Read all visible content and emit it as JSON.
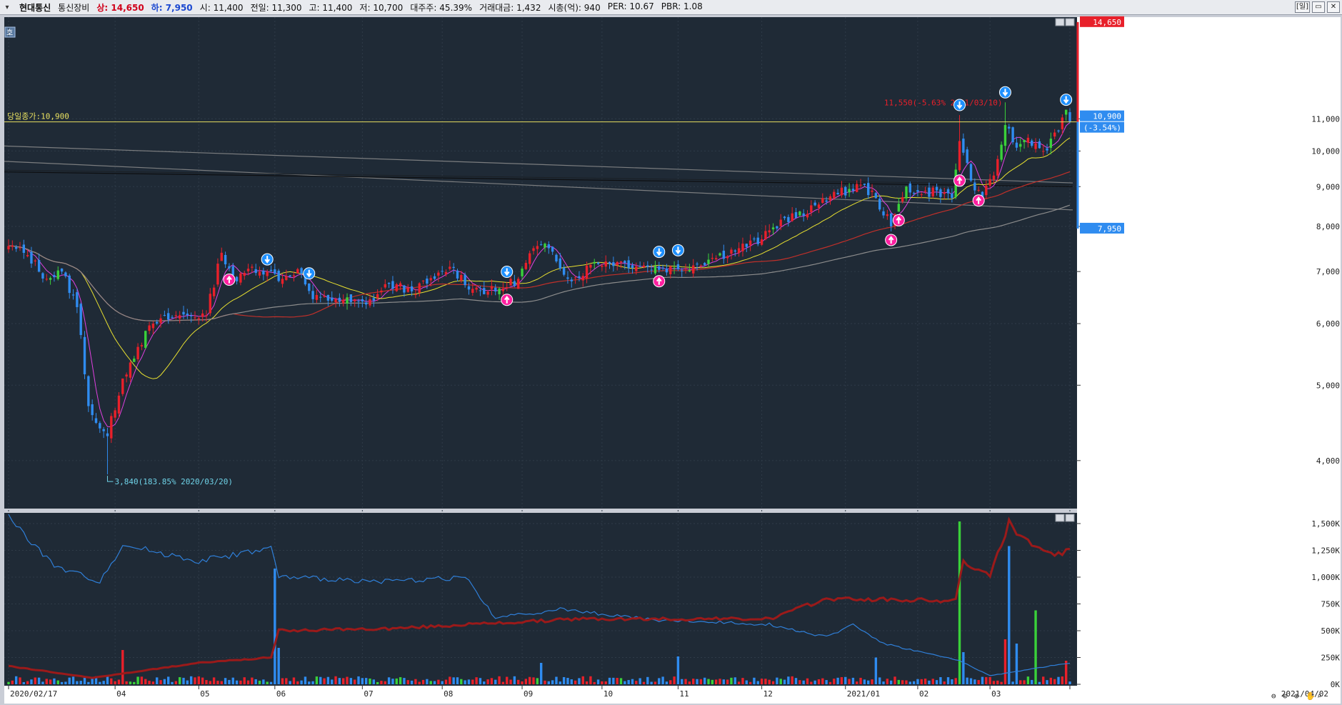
{
  "header": {
    "menu_icon": "chevron-down-icon",
    "stock_name": "현대통신",
    "sector": "통신장비",
    "items": [
      {
        "label": "상:",
        "value": "14,650",
        "color": "up"
      },
      {
        "label": "하:",
        "value": "7,950",
        "color": "dn"
      },
      {
        "label": "시:",
        "value": "11,400",
        "color": "plain"
      },
      {
        "label": "전일:",
        "value": "11,300",
        "color": "plain"
      },
      {
        "label": "고:",
        "value": "11,400",
        "color": "plain"
      },
      {
        "label": "저:",
        "value": "10,700",
        "color": "plain"
      },
      {
        "label": "대주주:",
        "value": "45.39%",
        "color": "plain"
      },
      {
        "label": "거래대금:",
        "value": "1,432",
        "color": "plain"
      },
      {
        "label": "시총(억):",
        "value": "940",
        "color": "plain"
      },
      {
        "label": "PER:",
        "value": "10.67",
        "color": "plain"
      },
      {
        "label": "PBR:",
        "value": "1.08",
        "color": "plain"
      }
    ],
    "period_button": "[일]",
    "window_buttons": [
      "▭",
      "✕"
    ]
  },
  "colors": {
    "background": "#1f2a36",
    "grid": "#2f3b48",
    "up": "#e8202a",
    "down": "#2f8cf0",
    "up_alt": "#3ad13a",
    "ma5": "#e040e0",
    "ma20": "#e8e030",
    "ma60": "#c0302a",
    "ma120": "#8c8c8c",
    "ref_line": "#e8e060",
    "hline": "#0a0a0a",
    "sell_signal": "#1e90ff",
    "buy_signal": "#ff1fa0",
    "vol_line_red": "#9b1a1a",
    "vol_line_blue": "#2f7fd8"
  },
  "panel_label": "호",
  "chart_data": {
    "type": "candlestick",
    "x_start": "2020/02/17",
    "x_end": "2021/04/02",
    "month_ticks": [
      "2020/02/17",
      "04",
      "05",
      "06",
      "07",
      "08",
      "09",
      "10",
      "11",
      "12",
      "2021/01",
      "02",
      "03",
      "2021/04/02"
    ],
    "price_axis": {
      "ticks": [
        4000,
        5000,
        6000,
        7000,
        8000,
        9000,
        10000,
        11000
      ],
      "labels": [
        "4,000",
        "5,000",
        "6,000",
        "7,000",
        "8,000",
        "9,000",
        "10,000",
        "11,000"
      ],
      "ylim": [
        3500,
        14800
      ]
    },
    "volume_axis": {
      "ticks": [
        0,
        250,
        500,
        750,
        1000,
        1250,
        1500
      ],
      "labels": [
        "0K",
        "250K",
        "500K",
        "750K",
        "1,000K",
        "1,250K",
        "1,500K"
      ],
      "ylim": [
        0,
        1560
      ]
    },
    "ref_line": {
      "label": "당일종가:10,900",
      "value": 10900
    },
    "annotations": [
      {
        "text": "3,840(183.85% 2020/03/20)",
        "date_index": 26,
        "value": 3840
      },
      {
        "text": "11,550(-5.63% 2021/03/10)",
        "date_index": 262,
        "value": 11550
      }
    ],
    "price_tags": [
      {
        "text": "14,650",
        "kind": "upper",
        "value": 14650
      },
      {
        "text": "10,900",
        "kind": "current",
        "value": 10900
      },
      {
        "text": "(-3.54%)",
        "kind": "current_pct",
        "value": 10900
      },
      {
        "text": "7,950",
        "kind": "lower",
        "value": 7950
      }
    ],
    "key_points": [
      {
        "i": 0,
        "c": 7550
      },
      {
        "i": 5,
        "c": 7350
      },
      {
        "i": 10,
        "c": 6850
      },
      {
        "i": 14,
        "c": 7000
      },
      {
        "i": 18,
        "c": 6300
      },
      {
        "i": 21,
        "c": 4700
      },
      {
        "i": 24,
        "c": 4400
      },
      {
        "i": 26,
        "c": 4300
      },
      {
        "i": 30,
        "c": 5100
      },
      {
        "i": 34,
        "c": 5600
      },
      {
        "i": 38,
        "c": 6000
      },
      {
        "i": 45,
        "c": 6150
      },
      {
        "i": 52,
        "c": 6150
      },
      {
        "i": 56,
        "c": 7400
      },
      {
        "i": 60,
        "c": 6800
      },
      {
        "i": 64,
        "c": 7100
      },
      {
        "i": 68,
        "c": 7000
      },
      {
        "i": 72,
        "c": 6850
      },
      {
        "i": 76,
        "c": 7050
      },
      {
        "i": 80,
        "c": 6450
      },
      {
        "i": 86,
        "c": 6450
      },
      {
        "i": 94,
        "c": 6350
      },
      {
        "i": 100,
        "c": 6750
      },
      {
        "i": 106,
        "c": 6600
      },
      {
        "i": 112,
        "c": 6850
      },
      {
        "i": 116,
        "c": 7100
      },
      {
        "i": 122,
        "c": 6650
      },
      {
        "i": 128,
        "c": 6600
      },
      {
        "i": 134,
        "c": 6850
      },
      {
        "i": 138,
        "c": 7500
      },
      {
        "i": 142,
        "c": 7500
      },
      {
        "i": 148,
        "c": 6800
      },
      {
        "i": 154,
        "c": 7200
      },
      {
        "i": 160,
        "c": 7200
      },
      {
        "i": 168,
        "c": 7100
      },
      {
        "i": 176,
        "c": 7050
      },
      {
        "i": 184,
        "c": 7250
      },
      {
        "i": 192,
        "c": 7500
      },
      {
        "i": 198,
        "c": 7700
      },
      {
        "i": 204,
        "c": 8200
      },
      {
        "i": 210,
        "c": 8300
      },
      {
        "i": 214,
        "c": 8700
      },
      {
        "i": 218,
        "c": 8800
      },
      {
        "i": 224,
        "c": 9050
      },
      {
        "i": 228,
        "c": 8700
      },
      {
        "i": 232,
        "c": 8000
      },
      {
        "i": 236,
        "c": 9000
      },
      {
        "i": 240,
        "c": 8800
      },
      {
        "i": 244,
        "c": 8900
      },
      {
        "i": 248,
        "c": 8700
      },
      {
        "i": 250,
        "c": 10300
      },
      {
        "i": 254,
        "c": 8900
      },
      {
        "i": 256,
        "c": 8700
      },
      {
        "i": 259,
        "c": 9300
      },
      {
        "i": 262,
        "c": 10800
      },
      {
        "i": 265,
        "c": 10100
      },
      {
        "i": 268,
        "c": 10400
      },
      {
        "i": 272,
        "c": 10000
      },
      {
        "i": 276,
        "c": 10600
      },
      {
        "i": 278,
        "c": 11300
      },
      {
        "i": 279,
        "c": 10900
      }
    ],
    "n_days": 280,
    "moving_averages": [
      {
        "period": 5,
        "color_key": "ma5"
      },
      {
        "period": 20,
        "color_key": "ma20"
      },
      {
        "period": 60,
        "color_key": "ma60"
      },
      {
        "period": 120,
        "color_key": "ma120"
      }
    ],
    "long_lines": [
      {
        "start": 10150,
        "end": 9100,
        "color_key": "ma120"
      },
      {
        "start": 9700,
        "end": 8400,
        "color_key": "ma120"
      },
      {
        "start": 9400,
        "end": 9000,
        "color_key": "hline"
      }
    ],
    "sell_signals": [
      68,
      79,
      131,
      171,
      176,
      250,
      262,
      278
    ],
    "buy_signals": [
      58,
      131,
      171,
      232,
      234,
      250,
      255
    ],
    "volume_spikes": [
      {
        "i": 30,
        "v": 320
      },
      {
        "i": 70,
        "v": 1080
      },
      {
        "i": 71,
        "v": 340
      },
      {
        "i": 140,
        "v": 200
      },
      {
        "i": 176,
        "v": 260
      },
      {
        "i": 228,
        "v": 250
      },
      {
        "i": 250,
        "v": 1520
      },
      {
        "i": 251,
        "v": 300
      },
      {
        "i": 262,
        "v": 420
      },
      {
        "i": 263,
        "v": 1290
      },
      {
        "i": 265,
        "v": 380
      },
      {
        "i": 270,
        "v": 690
      },
      {
        "i": 278,
        "v": 220
      }
    ],
    "volume_line_red_points": [
      {
        "i": 0,
        "v": 170
      },
      {
        "i": 22,
        "v": 60
      },
      {
        "i": 50,
        "v": 200
      },
      {
        "i": 69,
        "v": 250
      },
      {
        "i": 71,
        "v": 500
      },
      {
        "i": 100,
        "v": 520
      },
      {
        "i": 150,
        "v": 610
      },
      {
        "i": 200,
        "v": 610
      },
      {
        "i": 215,
        "v": 800
      },
      {
        "i": 249,
        "v": 780
      },
      {
        "i": 251,
        "v": 1150
      },
      {
        "i": 258,
        "v": 1010
      },
      {
        "i": 263,
        "v": 1500
      },
      {
        "i": 270,
        "v": 1260
      },
      {
        "i": 275,
        "v": 1190
      },
      {
        "i": 279,
        "v": 1280
      }
    ],
    "volume_line_blue_points": [
      {
        "i": 0,
        "v": 1560
      },
      {
        "i": 12,
        "v": 1100
      },
      {
        "i": 24,
        "v": 960
      },
      {
        "i": 30,
        "v": 1300
      },
      {
        "i": 50,
        "v": 1150
      },
      {
        "i": 69,
        "v": 1270
      },
      {
        "i": 71,
        "v": 1000
      },
      {
        "i": 100,
        "v": 960
      },
      {
        "i": 120,
        "v": 1000
      },
      {
        "i": 128,
        "v": 620
      },
      {
        "i": 145,
        "v": 700
      },
      {
        "i": 170,
        "v": 600
      },
      {
        "i": 200,
        "v": 560
      },
      {
        "i": 215,
        "v": 440
      },
      {
        "i": 222,
        "v": 560
      },
      {
        "i": 230,
        "v": 380
      },
      {
        "i": 250,
        "v": 220
      },
      {
        "i": 258,
        "v": 80
      },
      {
        "i": 279,
        "v": 200
      }
    ]
  }
}
